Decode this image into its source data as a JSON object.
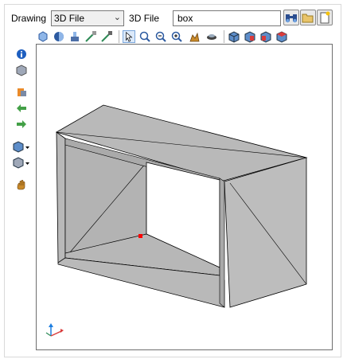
{
  "drawing_label": "Drawing",
  "drawing_select": {
    "value": "3D File"
  },
  "file_label": "3D File",
  "file_input": {
    "value": "box"
  },
  "colors": {
    "accent_blue": "#1e7ee0",
    "box_gray": "#b9b9b9",
    "frame_border": "#6e6e6e",
    "marker_red": "#ff0000"
  },
  "icons": {
    "top_buttons": [
      "binoculars-icon",
      "folder-open-icon",
      "new-document-icon"
    ],
    "toolbar": [
      "shade-icon",
      "sphere-icon",
      "assembly-icon",
      "explode-icon",
      "collapse-icon",
      "select-arrow-icon",
      "zoom-window-icon",
      "zoom-out-icon",
      "zoom-in-icon",
      "pan-icon",
      "rotate-icon",
      "cube-view-icon",
      "front-view-icon",
      "side-view-icon",
      "top-view-icon"
    ],
    "left_tools": [
      "info-icon",
      "cube-icon",
      "paint-icon",
      "arrow-left-icon",
      "arrow-right-icon",
      "view-dropdown-icon",
      "shade-dropdown-icon",
      "hand-icon"
    ]
  }
}
